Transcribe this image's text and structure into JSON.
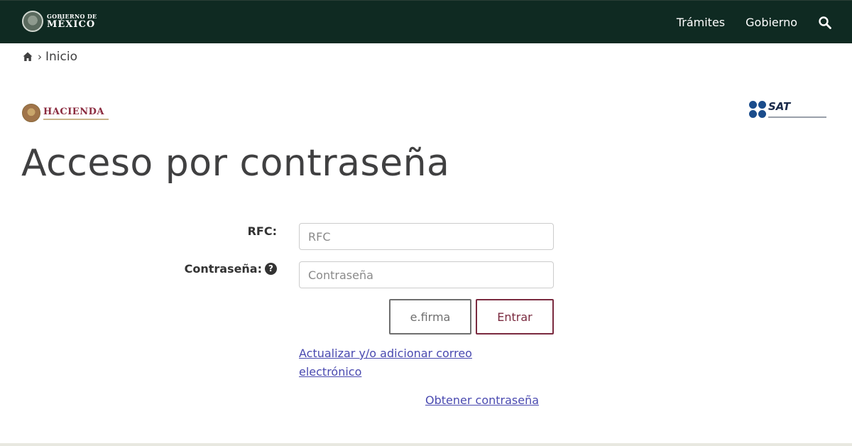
{
  "header": {
    "logo_line1": "GOBIERNO DE",
    "logo_line2": "MÉXICO",
    "nav": [
      {
        "label": "Trámites"
      },
      {
        "label": "Gobierno"
      }
    ],
    "search_icon": "search-icon",
    "background_color": "#0f2a22"
  },
  "breadcrumb": {
    "home_icon": "home-icon",
    "separator": "›",
    "current": "Inicio"
  },
  "brands": {
    "hacienda": "HACIENDA",
    "sat": "SAT"
  },
  "page": {
    "title": "Acceso por contraseña"
  },
  "form": {
    "rfc_label": "RFC:",
    "rfc_placeholder": "RFC",
    "rfc_value": "",
    "password_label": "Contraseña:",
    "password_placeholder": "Contraseña",
    "password_value": "",
    "help_icon": "question-circle-icon",
    "efirma_button": "e.firma",
    "submit_button": "Entrar",
    "accent_color": "#7a2a3f"
  },
  "links": {
    "update_email": "Actualizar y/o adicionar correo electrónico",
    "obtain_password": "Obtener contraseña"
  }
}
